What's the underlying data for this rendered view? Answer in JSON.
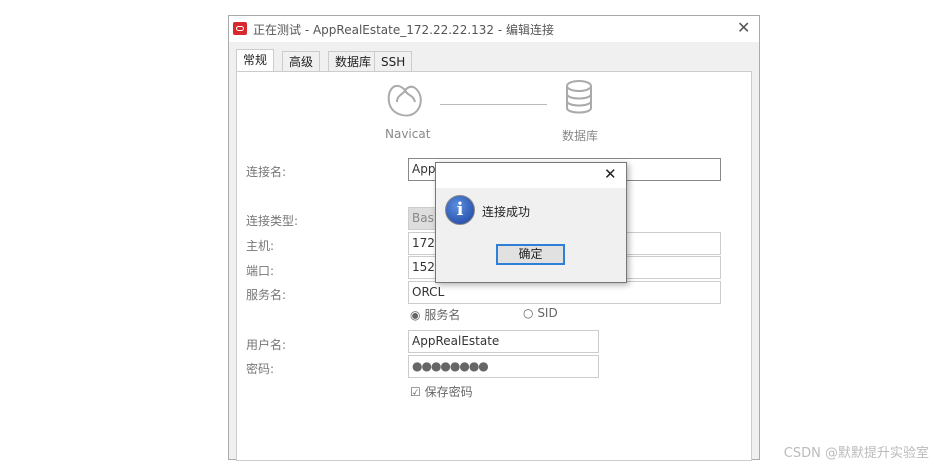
{
  "window": {
    "title": "正在测试 - AppRealEstate_172.22.22.132 - 编辑连接"
  },
  "tabs": [
    "常规",
    "高级",
    "数据库",
    "SSH"
  ],
  "diagram": {
    "left": "Navicat",
    "right": "数据库"
  },
  "form": {
    "conn_name": {
      "label": "连接名:",
      "value": "App"
    },
    "conn_type": {
      "label": "连接类型:",
      "value": "Basi"
    },
    "host": {
      "label": "主机:",
      "value": "172."
    },
    "port": {
      "label": "端口:",
      "value": "1521"
    },
    "service": {
      "label": "服务名:",
      "value": "ORCL"
    },
    "radio_service": "服务名",
    "radio_sid": "SID",
    "user": {
      "label": "用户名:",
      "value": "AppRealEstate"
    },
    "password": {
      "label": "密码:",
      "value": "●●●●●●●●"
    },
    "save_password": "保存密码"
  },
  "dialog": {
    "message": "连接成功",
    "ok": "确定"
  },
  "watermark": "CSDN @默默提升实验室"
}
